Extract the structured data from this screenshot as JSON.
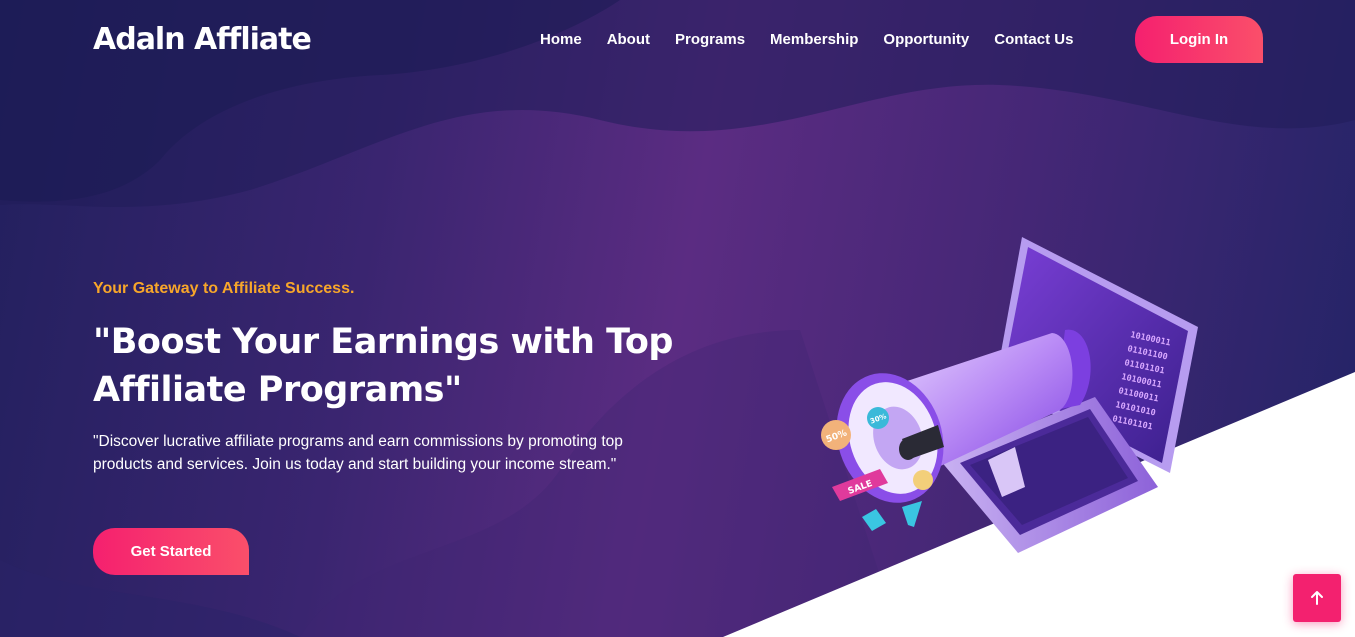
{
  "header": {
    "logo": "Adaln Affliate",
    "nav": [
      "Home",
      "About",
      "Programs",
      "Membership",
      "Opportunity",
      "Contact Us"
    ],
    "login_label": "Login In"
  },
  "hero": {
    "tagline": "Your Gateway to Affiliate Success.",
    "headline": "\"Boost Your Earnings with Top Affiliate Programs\"",
    "description": "\"Discover lucrative affiliate programs and earn commissions by promoting top products and services. Join us today and start building your income stream.\"",
    "cta_label": "Get Started"
  },
  "illustration": {
    "binary_lines": [
      "10100011",
      "01101100",
      "01101101",
      "10100011",
      "01100011",
      "10101010",
      "01101101"
    ],
    "badges": [
      "50%",
      "30%",
      "SALE"
    ]
  },
  "colors": {
    "accent": "#f5206f",
    "tagline": "#f7a62a",
    "background_dark": "#22205e",
    "background_mid": "#5b2c82"
  },
  "icons": {
    "scroll_top": "arrow-up-icon"
  }
}
